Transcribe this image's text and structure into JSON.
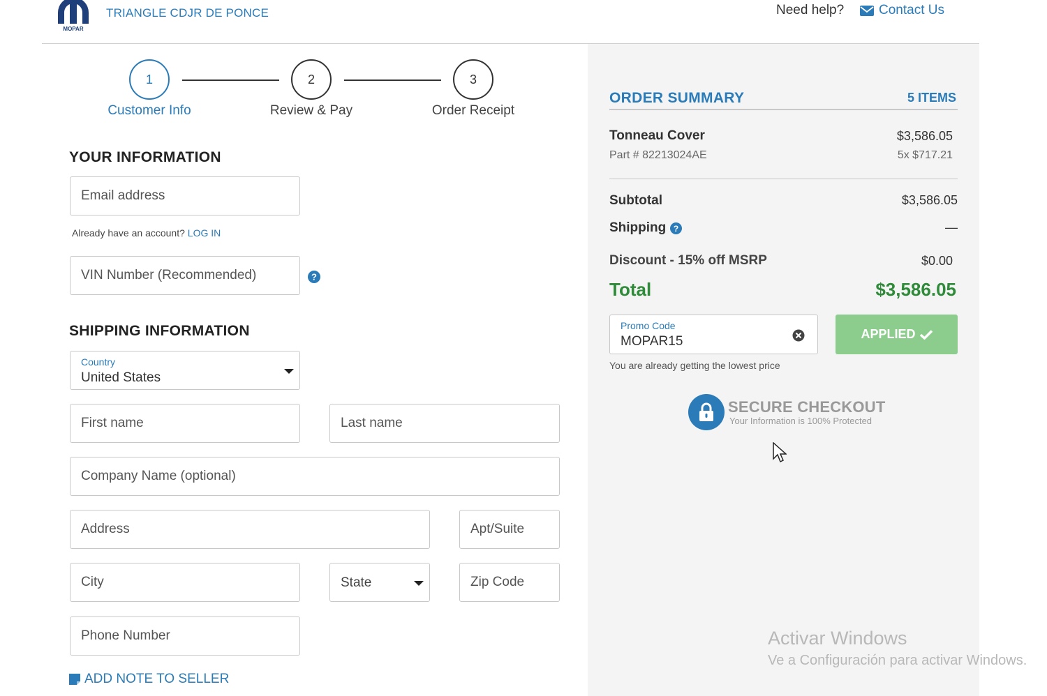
{
  "header": {
    "dealer_name": "TRIANGLE CDJR DE PONCE",
    "need_help": "Need help?",
    "contact_label": "Contact Us",
    "logo_text": "MOPAR"
  },
  "stepper": {
    "steps": [
      {
        "number": "1",
        "label": "Customer Info",
        "active": true
      },
      {
        "number": "2",
        "label": "Review & Pay",
        "active": false
      },
      {
        "number": "3",
        "label": "Order Receipt",
        "active": false
      }
    ]
  },
  "your_information": {
    "title": "YOUR INFORMATION",
    "email_placeholder": "Email address",
    "account_prompt": "Already have an account?",
    "login_label": "LOG IN",
    "vin_placeholder": "VIN Number (Recommended)"
  },
  "shipping": {
    "title": "SHIPPING INFORMATION",
    "country_label": "Country",
    "country_value": "United States",
    "first_name_placeholder": "First name",
    "last_name_placeholder": "Last name",
    "company_placeholder": "Company Name (optional)",
    "address_placeholder": "Address",
    "apt_placeholder": "Apt/Suite",
    "city_placeholder": "City",
    "state_placeholder": "State",
    "zip_placeholder": "Zip Code",
    "phone_placeholder": "Phone Number",
    "add_note_label": "ADD NOTE TO SELLER"
  },
  "summary": {
    "title": "ORDER SUMMARY",
    "items_count": "5 ITEMS",
    "product_name": "Tonneau Cover",
    "product_price": "$3,586.05",
    "part_number": "Part # 82213024AE",
    "qty_price": "5x $717.21",
    "subtotal_label": "Subtotal",
    "subtotal_value": "$3,586.05",
    "shipping_label": "Shipping",
    "shipping_value": "—",
    "discount_label": "Discount - 15% off MSRP",
    "discount_value": "$0.00",
    "total_label": "Total",
    "total_value": "$3,586.05",
    "promo_label": "Promo Code",
    "promo_value": "MOPAR15",
    "applied_label": "APPLIED",
    "lowest_price_note": "You are already getting the lowest price",
    "secure_title": "SECURE CHECKOUT",
    "secure_sub": "Your Information is 100% Protected"
  },
  "watermark": {
    "line1": "Activar Windows",
    "line2": "Ve a Configuración para activar Windows."
  },
  "colors": {
    "accent": "#2a7bb8",
    "total_green": "#2f8a3a",
    "applied_green": "#8ccc8c",
    "panel_bg": "#f4f4f4"
  }
}
